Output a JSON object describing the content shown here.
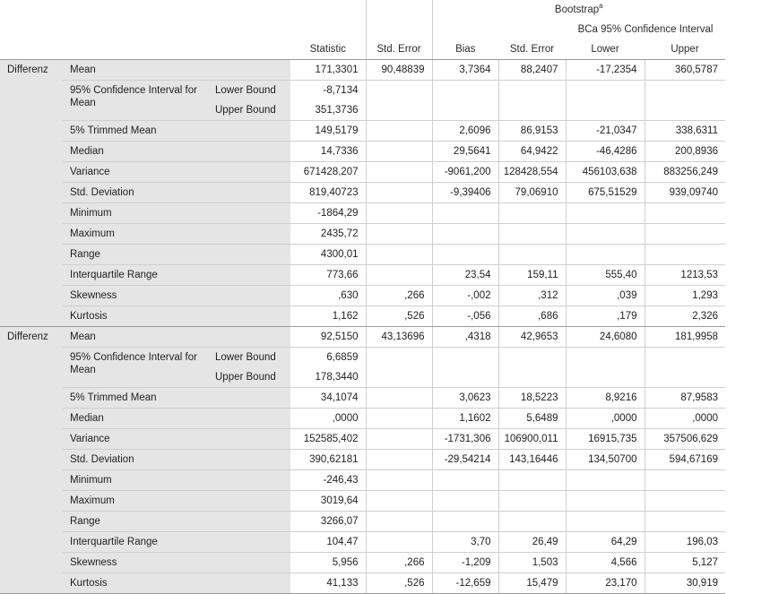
{
  "header": {
    "bootstrap": "Bootstrap",
    "bootstrap_sup": "a",
    "bca": "BCa 95% Confidence Interval",
    "statistic": "Statistic",
    "std_error": "Std. Error",
    "bias": "Bias",
    "boot_std_error": "Std. Error",
    "lower": "Lower",
    "upper": "Upper"
  },
  "groups": [
    {
      "variable": "Differenz",
      "ci_label": "95% Confidence Interval for Mean",
      "lower_bound": "Lower Bound",
      "upper_bound": "Upper Bound",
      "rows": [
        {
          "label": "Mean",
          "statistic": "171,3301",
          "std_error": "90,48839",
          "bias": "3,7364",
          "boot_se": "88,2407",
          "lower": "-17,2354",
          "upper": "360,5787"
        },
        {
          "label": "",
          "statistic": "-8,7134",
          "std_error": "",
          "bias": "",
          "boot_se": "",
          "lower": "",
          "upper": ""
        },
        {
          "label": "",
          "statistic": "351,3736",
          "std_error": "",
          "bias": "",
          "boot_se": "",
          "lower": "",
          "upper": ""
        },
        {
          "label": "5% Trimmed Mean",
          "statistic": "149,5179",
          "std_error": "",
          "bias": "2,6096",
          "boot_se": "86,9153",
          "lower": "-21,0347",
          "upper": "338,6311"
        },
        {
          "label": "Median",
          "statistic": "14,7336",
          "std_error": "",
          "bias": "29,5641",
          "boot_se": "64,9422",
          "lower": "-46,4286",
          "upper": "200,8936"
        },
        {
          "label": "Variance",
          "statistic": "671428,207",
          "std_error": "",
          "bias": "-9061,200",
          "boot_se": "128428,554",
          "lower": "456103,638",
          "upper": "883256,249"
        },
        {
          "label": "Std. Deviation",
          "statistic": "819,40723",
          "std_error": "",
          "bias": "-9,39406",
          "boot_se": "79,06910",
          "lower": "675,51529",
          "upper": "939,09740"
        },
        {
          "label": "Minimum",
          "statistic": "-1864,29",
          "std_error": "",
          "bias": "",
          "boot_se": "",
          "lower": "",
          "upper": ""
        },
        {
          "label": "Maximum",
          "statistic": "2435,72",
          "std_error": "",
          "bias": "",
          "boot_se": "",
          "lower": "",
          "upper": ""
        },
        {
          "label": "Range",
          "statistic": "4300,01",
          "std_error": "",
          "bias": "",
          "boot_se": "",
          "lower": "",
          "upper": ""
        },
        {
          "label": "Interquartile Range",
          "statistic": "773,66",
          "std_error": "",
          "bias": "23,54",
          "boot_se": "159,11",
          "lower": "555,40",
          "upper": "1213,53"
        },
        {
          "label": "Skewness",
          "statistic": ",630",
          "std_error": ",266",
          "bias": "-,002",
          "boot_se": ",312",
          "lower": ",039",
          "upper": "1,293"
        },
        {
          "label": "Kurtosis",
          "statistic": "1,162",
          "std_error": ",526",
          "bias": "-,056",
          "boot_se": ",686",
          "lower": ",179",
          "upper": "2,326"
        }
      ]
    },
    {
      "variable": "Differenz",
      "ci_label": "95% Confidence Interval for Mean",
      "lower_bound": "Lower Bound",
      "upper_bound": "Upper Bound",
      "rows": [
        {
          "label": "Mean",
          "statistic": "92,5150",
          "std_error": "43,13696",
          "bias": ",4318",
          "boot_se": "42,9653",
          "lower": "24,6080",
          "upper": "181,9958"
        },
        {
          "label": "",
          "statistic": "6,6859",
          "std_error": "",
          "bias": "",
          "boot_se": "",
          "lower": "",
          "upper": ""
        },
        {
          "label": "",
          "statistic": "178,3440",
          "std_error": "",
          "bias": "",
          "boot_se": "",
          "lower": "",
          "upper": ""
        },
        {
          "label": "5% Trimmed Mean",
          "statistic": "34,1074",
          "std_error": "",
          "bias": "3,0623",
          "boot_se": "18,5223",
          "lower": "8,9216",
          "upper": "87,9583"
        },
        {
          "label": "Median",
          "statistic": ",0000",
          "std_error": "",
          "bias": "1,1602",
          "boot_se": "5,6489",
          "lower": ",0000",
          "upper": ",0000"
        },
        {
          "label": "Variance",
          "statistic": "152585,402",
          "std_error": "",
          "bias": "-1731,306",
          "boot_se": "106900,011",
          "lower": "16915,735",
          "upper": "357506,629"
        },
        {
          "label": "Std. Deviation",
          "statistic": "390,62181",
          "std_error": "",
          "bias": "-29,54214",
          "boot_se": "143,16446",
          "lower": "134,50700",
          "upper": "594,67169"
        },
        {
          "label": "Minimum",
          "statistic": "-246,43",
          "std_error": "",
          "bias": "",
          "boot_se": "",
          "lower": "",
          "upper": ""
        },
        {
          "label": "Maximum",
          "statistic": "3019,64",
          "std_error": "",
          "bias": "",
          "boot_se": "",
          "lower": "",
          "upper": ""
        },
        {
          "label": "Range",
          "statistic": "3266,07",
          "std_error": "",
          "bias": "",
          "boot_se": "",
          "lower": "",
          "upper": ""
        },
        {
          "label": "Interquartile Range",
          "statistic": "104,47",
          "std_error": "",
          "bias": "3,70",
          "boot_se": "26,49",
          "lower": "64,29",
          "upper": "196,03"
        },
        {
          "label": "Skewness",
          "statistic": "5,956",
          "std_error": ",266",
          "bias": "-1,209",
          "boot_se": "1,503",
          "lower": "4,566",
          "upper": "5,127"
        },
        {
          "label": "Kurtosis",
          "statistic": "41,133",
          "std_error": ",526",
          "bias": "-12,659",
          "boot_se": "15,479",
          "lower": "23,170",
          "upper": "30,919"
        }
      ]
    }
  ]
}
